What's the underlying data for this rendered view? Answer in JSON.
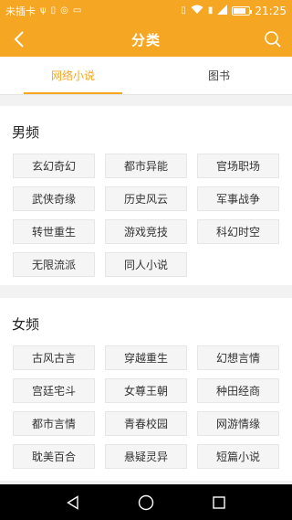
{
  "status_bar": {
    "carrier": "未插卡",
    "time": "21:25",
    "left_icons": [
      "usb-icon",
      "storage-icon",
      "hotspot-icon",
      "mail-icon"
    ],
    "right_icons": [
      "vibrate-icon",
      "wifi-icon",
      "sim-icon",
      "signal-icon",
      "battery-icon"
    ]
  },
  "app_bar": {
    "title": "分类",
    "back_icon": "chevron-left-icon",
    "search_icon": "search-icon",
    "color": "#f5a623"
  },
  "tabs": [
    {
      "label": "网络小说",
      "active": true
    },
    {
      "label": "图书",
      "active": false
    }
  ],
  "sections": {
    "male": {
      "title": "男频",
      "tags": [
        "玄幻奇幻",
        "都市异能",
        "官场职场",
        "武侠奇缘",
        "历史风云",
        "军事战争",
        "转世重生",
        "游戏竞技",
        "科幻时空",
        "无限流派",
        "同人小说"
      ]
    },
    "female": {
      "title": "女频",
      "tags": [
        "古风古言",
        "穿越重生",
        "幻想言情",
        "宫廷宅斗",
        "女尊王朝",
        "种田经商",
        "都市言情",
        "青春校园",
        "网游情缘",
        "耽美百合",
        "悬疑灵异",
        "短篇小说"
      ]
    }
  },
  "nav_bar": {
    "icons": [
      "back-triangle-icon",
      "home-circle-icon",
      "recents-square-icon"
    ]
  }
}
